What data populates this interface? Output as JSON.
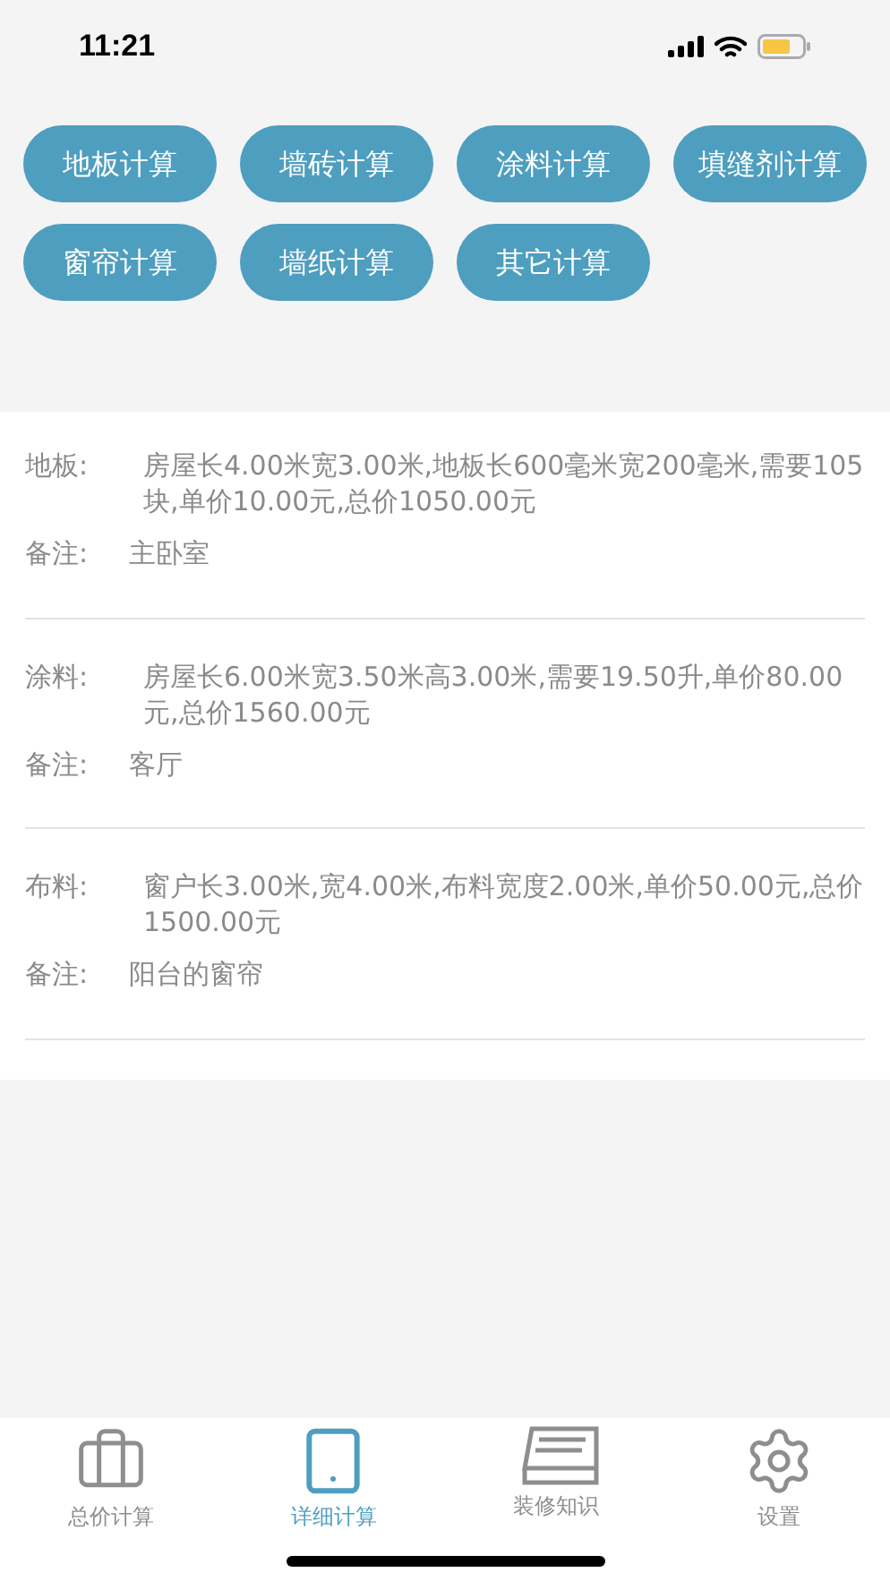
{
  "status_bar": {
    "time": "11:21"
  },
  "calc_buttons": [
    "地板计算",
    "墙砖计算",
    "涂料计算",
    "填缝剂计算",
    "窗帘计算",
    "墙纸计算",
    "其它计算"
  ],
  "records": [
    {
      "label": "地板:",
      "detail": "房屋长4.00米宽3.00米,地板长600毫米宽200毫米,需要105块,单价10.00元,总价1050.00元",
      "note_label": "备注:",
      "note": "主卧室"
    },
    {
      "label": "涂料:",
      "detail": "房屋长6.00米宽3.50米高3.00米,需要19.50升,单价80.00元,总价1560.00元",
      "note_label": "备注:",
      "note": "客厅"
    },
    {
      "label": "布料:",
      "detail": "窗户长3.00米,宽4.00米,布料宽度2.00米,单价50.00元,总价1500.00元",
      "note_label": "备注:",
      "note": "阳台的窗帘"
    }
  ],
  "tab_bar": [
    {
      "kind": "briefcase",
      "label": "总价计算",
      "selected": false
    },
    {
      "kind": "tablet",
      "label": "详细计算",
      "selected": true
    },
    {
      "kind": "book",
      "label": "装修知识",
      "selected": false
    },
    {
      "kind": "gear",
      "label": "设置",
      "selected": false
    }
  ]
}
